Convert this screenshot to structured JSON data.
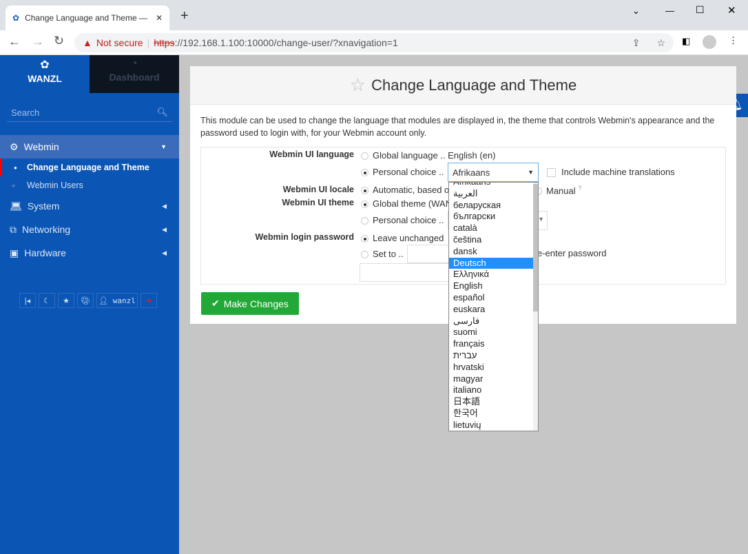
{
  "browser": {
    "tab_title": "Change Language and Theme —",
    "new_tab": "+",
    "security": "Not secure",
    "url_scheme": "https",
    "url_rest": "://192.168.1.100:10000/change-user/?xnavigation=1"
  },
  "sidebar": {
    "brand": "WANZL",
    "dashboard": "Dashboard",
    "search_placeholder": "Search",
    "items": [
      {
        "label": "Webmin",
        "icon": "gear-icon",
        "expanded": true
      },
      {
        "label": "System",
        "icon": "laptop-icon"
      },
      {
        "label": "Networking",
        "icon": "network-icon"
      },
      {
        "label": "Hardware",
        "icon": "hdd-icon"
      }
    ],
    "subitems": [
      {
        "label": "Change Language and Theme",
        "active": true
      },
      {
        "label": "Webmin Users"
      }
    ],
    "toolbar_user": "wanzl"
  },
  "page": {
    "title": "Change Language and Theme",
    "description": "This module can be used to change the language that modules are displayed in, the theme that controls Webmin's appearance and the password used to login with, for your Webmin account only.",
    "lang_label": "Webmin UI language",
    "lang_global": "Global language .. English (en)",
    "lang_personal": "Personal choice ..",
    "lang_selected": "Afrikaans",
    "machine_translations": "Include machine translations",
    "locale_label": "Webmin UI locale",
    "locale_auto": "Automatic, based o",
    "locale_manual": "Manual",
    "theme_label": "Webmin UI theme",
    "theme_global": "Global theme (WAN",
    "theme_personal": "Personal choice ..",
    "pw_label": "Webmin login password",
    "pw_leave": "Leave unchanged",
    "pw_set": "Set to ..",
    "pw_reenter": "e-enter password",
    "submit": "Make Changes"
  },
  "dropdown": {
    "highlighted": "Deutsch",
    "options": [
      "Afrikaans",
      "العربية",
      "беларуская",
      "български",
      "català",
      "čeština",
      "dansk",
      "Deutsch",
      "Ελληνικά",
      "English",
      "español",
      "euskara",
      "فارسی",
      "suomi",
      "français",
      "עברית",
      "hrvatski",
      "magyar",
      "italiano",
      "日本語",
      "한국어",
      "lietuvių"
    ]
  },
  "colors": {
    "sidebar": "#0b55b4",
    "accent": "#22a836",
    "highlight": "#1e90ff"
  }
}
